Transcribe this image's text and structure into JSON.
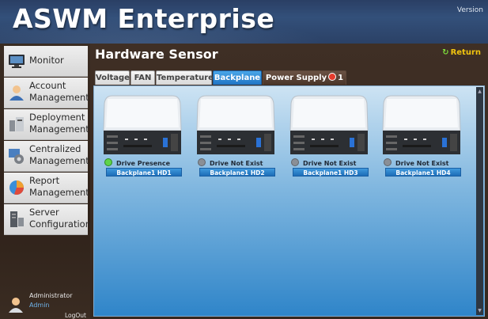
{
  "app": {
    "title": "ASWM Enterprise",
    "version": "Version"
  },
  "sidebar": {
    "items": [
      {
        "label": "Monitor",
        "icon": "monitor-icon"
      },
      {
        "label": "Account Management",
        "icon": "account-icon"
      },
      {
        "label": "Deployment Management",
        "icon": "deployment-icon"
      },
      {
        "label": "Centralized Management",
        "icon": "centralized-icon"
      },
      {
        "label": "Report Management",
        "icon": "report-icon"
      },
      {
        "label": "Server Configuration",
        "icon": "server-icon"
      }
    ]
  },
  "user": {
    "role": "Administrator",
    "name": "Admin",
    "logout": "LogOut"
  },
  "page": {
    "title": "Hardware Sensor",
    "return_label": "Return",
    "return_icon": "refresh-icon"
  },
  "tabs": [
    {
      "label": "Voltage"
    },
    {
      "label": "FAN"
    },
    {
      "label": "Temperature"
    },
    {
      "label": "Backplane",
      "active": true
    },
    {
      "label": "Power Supply",
      "alarm_count": "1"
    }
  ],
  "drives": [
    {
      "status": "Drive Presence",
      "status_state": "present",
      "label": "Backplane1 HD1"
    },
    {
      "status": "Drive Not Exist",
      "status_state": "absent",
      "label": "Backplane1 HD2"
    },
    {
      "status": "Drive Not Exist",
      "status_state": "absent",
      "label": "Backplane1 HD3"
    },
    {
      "status": "Drive Not Exist",
      "status_state": "absent",
      "label": "Backplane1 HD4"
    }
  ],
  "colors": {
    "accent": "#2f7fc8",
    "return": "#f1c40f",
    "present": "#5fd34a",
    "absent": "#8a8f96",
    "alarm": "#e53b2c"
  }
}
